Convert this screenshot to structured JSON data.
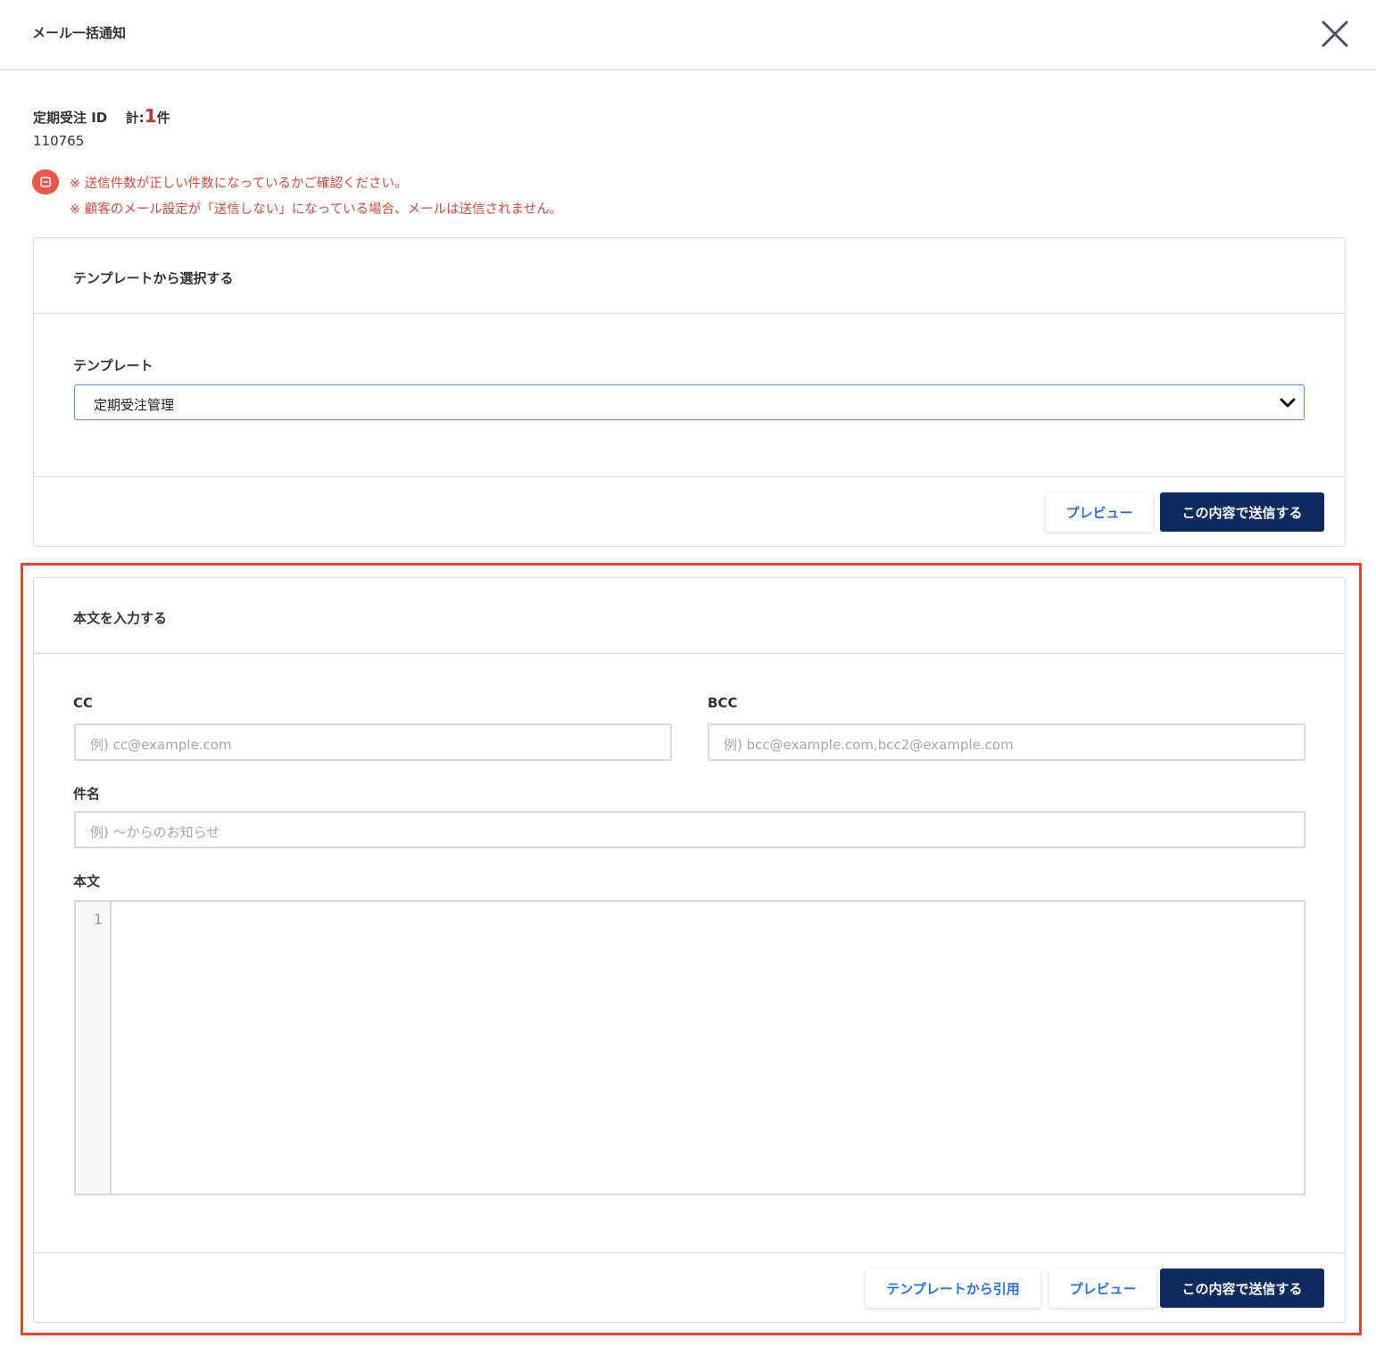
{
  "modal": {
    "title": "メール一括通知"
  },
  "summary": {
    "label": "定期受注 ID",
    "total_prefix": "計:",
    "total_count": "1",
    "total_suffix": "件",
    "ids": "110765"
  },
  "alerts": [
    "※ 送信件数が正しい件数になっているかご確認ください。",
    "※ 顧客のメール設定が「送信しない」になっている場合、メールは送信されません。"
  ],
  "template_card": {
    "title": "テンプレートから選択する",
    "template_label": "テンプレート",
    "template_selected": "定期受注管理",
    "preview_label": "プレビュー",
    "send_label": "この内容で送信する"
  },
  "body_card": {
    "title": "本文を入力する",
    "cc_label": "CC",
    "cc_placeholder": "例) cc@example.com",
    "bcc_label": "BCC",
    "bcc_placeholder": "例) bcc@example.com,bcc2@example.com",
    "subject_label": "件名",
    "subject_placeholder": "例) 〜からのお知らせ",
    "body_label": "本文",
    "line_number": "1",
    "quote_template_label": "テンプレートから引用",
    "preview_label": "プレビュー",
    "send_label": "この内容で送信する"
  },
  "colors": {
    "primary": "#0f2a5f",
    "link": "#2a6fe0",
    "alert": "#d84a3c",
    "highlight": "#e8422f"
  }
}
